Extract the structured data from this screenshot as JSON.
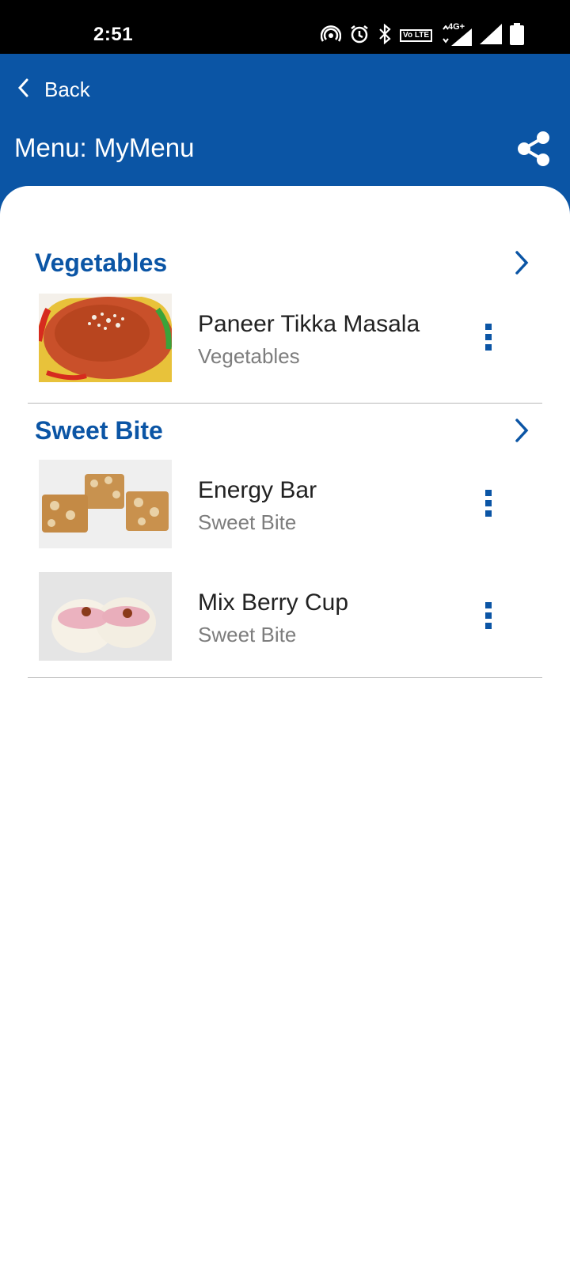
{
  "status_bar": {
    "time": "2:51",
    "icons": [
      "hotspot-icon",
      "alarm-icon",
      "bluetooth-icon",
      "volte-icon",
      "4g-signal-icon",
      "signal-icon",
      "battery-icon"
    ],
    "volte_text": "Vo LTE",
    "network": "4G+"
  },
  "header": {
    "back_label": "Back",
    "title": "Menu: MyMenu",
    "share_icon": "share-icon"
  },
  "colors": {
    "primary": "#0b55a5",
    "status_bar": "#000000",
    "secondary_text": "#7d7d7d"
  },
  "sections": [
    {
      "title": "Vegetables",
      "items": [
        {
          "name": "Paneer Tikka Masala",
          "category": "Vegetables"
        }
      ]
    },
    {
      "title": "Sweet Bite",
      "items": [
        {
          "name": "Energy Bar",
          "category": "Sweet Bite"
        },
        {
          "name": "Mix Berry Cup",
          "category": "Sweet Bite"
        }
      ]
    }
  ]
}
